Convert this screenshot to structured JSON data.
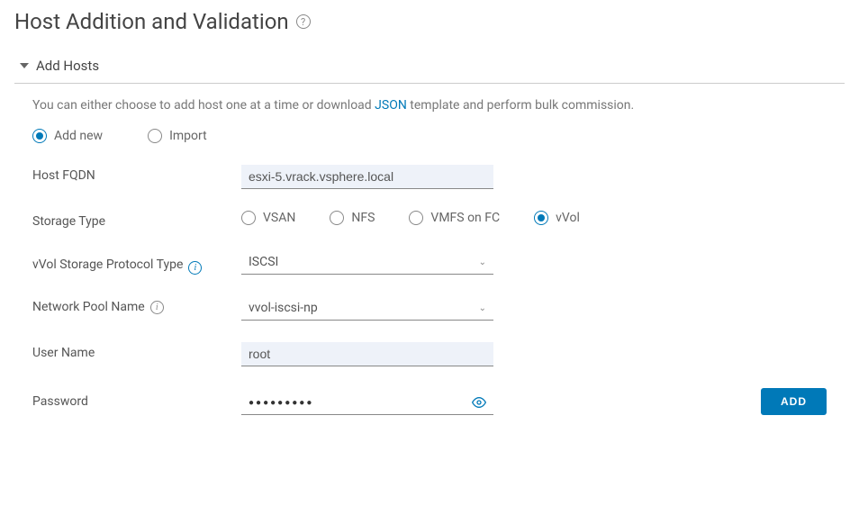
{
  "page": {
    "title": "Host Addition and Validation"
  },
  "section": {
    "title": "Add Hosts",
    "intro_prefix": "You can either choose to add host one at a time or download ",
    "intro_link": "JSON",
    "intro_suffix": " template and perform bulk commission."
  },
  "mode": {
    "add_new": "Add new",
    "import": "Import",
    "selected": "add_new"
  },
  "form": {
    "host_fqdn": {
      "label": "Host FQDN",
      "value": "esxi-5.vrack.vsphere.local"
    },
    "storage_type": {
      "label": "Storage Type",
      "options": {
        "vsan": "VSAN",
        "nfs": "NFS",
        "vmfs_fc": "VMFS on FC",
        "vvol": "vVol"
      },
      "selected": "vvol"
    },
    "vvol_protocol": {
      "label": "vVol Storage Protocol Type",
      "value": "ISCSI"
    },
    "network_pool": {
      "label": "Network Pool Name",
      "value": "vvol-iscsi-np"
    },
    "user_name": {
      "label": "User Name",
      "value": "root"
    },
    "password": {
      "label": "Password",
      "masked": "●●●●●●●●●"
    }
  },
  "buttons": {
    "add": "ADD"
  }
}
